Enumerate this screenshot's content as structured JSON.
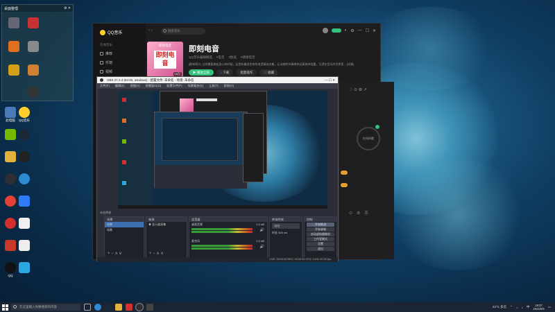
{
  "desktop": {
    "fence": {
      "title": "桌面整理",
      "ctl": "⚙ ✕"
    },
    "icons": [
      {
        "label": "此电脑"
      },
      {
        "label": "QQ音乐"
      },
      {
        "label": "GeForce Experience"
      },
      {
        "label": "Steam"
      },
      {
        "label": "WeGame"
      },
      {
        "label": "Logitech G HUB"
      },
      {
        "label": "OBS Studio"
      },
      {
        "label": "Microsoft Edge"
      },
      {
        "label": "Chrome"
      },
      {
        "label": "腾讯会议"
      },
      {
        "label": "网易云音乐"
      },
      {
        "label": "QQ"
      }
    ]
  },
  "qqmusic": {
    "logo": "QQ音乐",
    "nav_arrows": "‹ ›",
    "search_placeholder": "搜索音乐",
    "sidebar_title": "在线音乐",
    "sidebar_items": [
      "推荐",
      "乐馆",
      "视频",
      "电台"
    ],
    "cover_top": "即刻电音",
    "cover_text": "即刻电音",
    "cover_badge": "18万",
    "playlist_title": "即刻电音",
    "meta": [
      "QQ音乐编辑精选",
      "#电音",
      "#欧美",
      "#情绪电音"
    ],
    "desc": "[歌单简介] 当你需要放松身心的时候，这里有最适合你的电音精选合集，让动感的节奏带你远离城市喧嚣，沉浸在音乐的世界里... [详情]",
    "btn_play": "▶ 播放全部",
    "btn_download": "↓ 下载",
    "btn_batch": "批量操作",
    "btn_collect": "♡ 收藏",
    "right_icons": "♡ ⊙ ⚙ ↗",
    "right_circle": "在线听歌"
  },
  "obs": {
    "title": "OBS 27.2.4 (64-bit, windows) - 配置文件: 未命名 - 场景: 未命名",
    "win_controls": "— ☐ ✕",
    "menu": [
      "文件(F)",
      "编辑(E)",
      "视图(V)",
      "停靠窗口(D)",
      "配置文件(P)",
      "场景集合(S)",
      "工具(T)",
      "帮助(H)"
    ],
    "no_source": "未选择源",
    "docks": {
      "scenes": {
        "title": "场景",
        "items": [
          "场景",
          "场景"
        ]
      },
      "sources": {
        "title": "来源",
        "items": [
          "显示器采集"
        ]
      },
      "mixer": {
        "title": "混音器",
        "ch1": "桌面音频",
        "ch2": "麦克风",
        "db1": "0.0 dB",
        "db2": "0.0 dB"
      },
      "transitions": {
        "title": "转场特效",
        "type": "淡出",
        "duration_label": "时长",
        "duration": "300 ms"
      },
      "controls": {
        "title": "控制",
        "buttons": [
          "开始推流",
          "开始录制",
          "启动虚拟摄像机",
          "工作室模式",
          "设置",
          "退出"
        ]
      }
    },
    "status": "LIVE: 00:00:00    REC: 00:00:00    CPU: 0.6%, 60.00 fps",
    "dock_tools": "+ − ∧ ∨"
  },
  "taskbar": {
    "search_placeholder": "在这里输入你要搜索的内容",
    "weather": "23°C 多云",
    "time": "19:07",
    "date": "2022/6/5",
    "lang": "中"
  }
}
